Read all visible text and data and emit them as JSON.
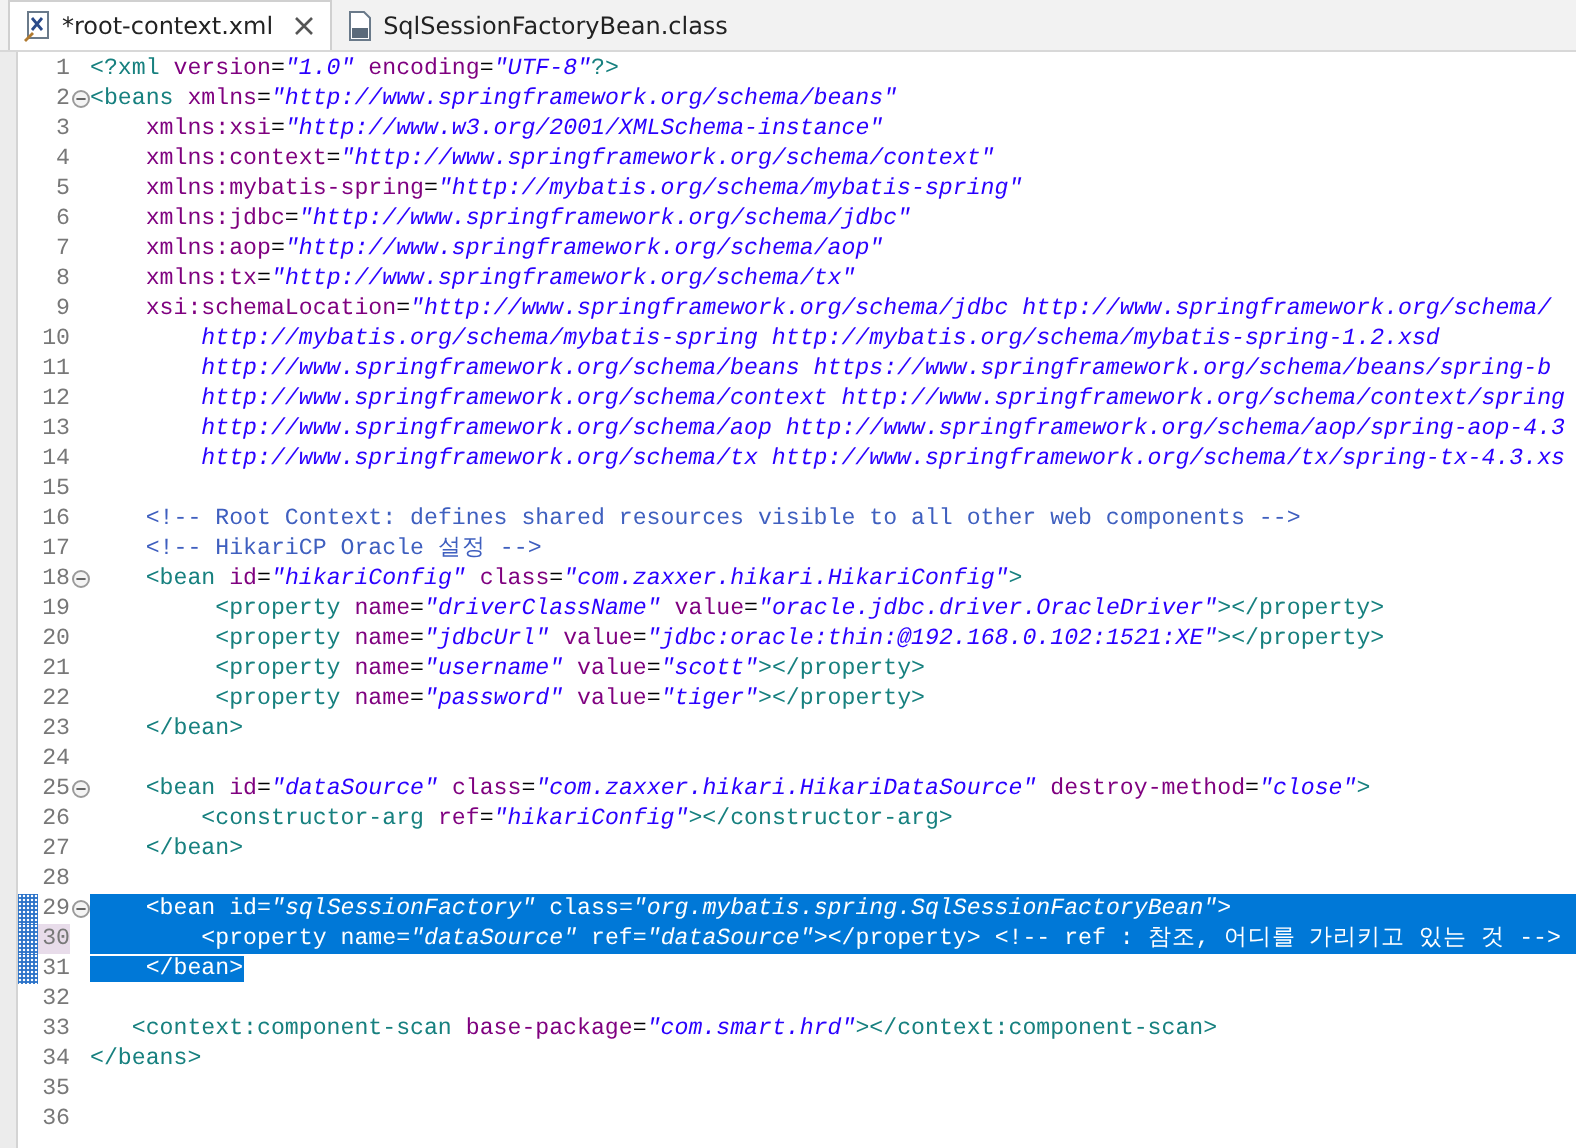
{
  "tabs": [
    {
      "label": "*root-context.xml",
      "selected": true,
      "kind": "xml",
      "closable": true
    },
    {
      "label": "SqlSessionFactoryBean.class",
      "selected": false,
      "kind": "class",
      "closable": false
    }
  ],
  "lines": [
    {
      "number": "1",
      "selected": false,
      "current": false,
      "changed": false,
      "tokens": [
        {
          "kind": "tag",
          "text": "<?xml "
        },
        {
          "kind": "attr",
          "text": "version"
        },
        {
          "kind": "eq",
          "text": "="
        },
        {
          "kind": "value",
          "text": "\"1.0\" "
        },
        {
          "kind": "attr",
          "text": "encoding"
        },
        {
          "kind": "eq",
          "text": "="
        },
        {
          "kind": "value",
          "text": "\"UTF-8\""
        },
        {
          "kind": "tag",
          "text": "?>"
        }
      ]
    },
    {
      "number": "2",
      "selected": false,
      "current": false,
      "changed": false,
      "expanded": true,
      "tokens": [
        {
          "kind": "tag",
          "text": "<beans "
        },
        {
          "kind": "attr",
          "text": "xmlns"
        },
        {
          "kind": "eq",
          "text": "="
        },
        {
          "kind": "value",
          "text": "\"http://www.springframework.org/schema/beans\""
        }
      ]
    },
    {
      "number": "3",
      "selected": false,
      "current": false,
      "changed": false,
      "tokens": [
        {
          "kind": "attr",
          "text": "    xmlns:xsi"
        },
        {
          "kind": "eq",
          "text": "="
        },
        {
          "kind": "value",
          "text": "\"http://www.w3.org/2001/XMLSchema-instance\""
        }
      ]
    },
    {
      "number": "4",
      "selected": false,
      "current": false,
      "changed": false,
      "tokens": [
        {
          "kind": "attr",
          "text": "    xmlns:context"
        },
        {
          "kind": "eq",
          "text": "="
        },
        {
          "kind": "value",
          "text": "\"http://www.springframework.org/schema/context\""
        }
      ]
    },
    {
      "number": "5",
      "selected": false,
      "current": false,
      "changed": false,
      "tokens": [
        {
          "kind": "attr",
          "text": "    xmlns:mybatis-spring"
        },
        {
          "kind": "eq",
          "text": "="
        },
        {
          "kind": "value",
          "text": "\"http://mybatis.org/schema/mybatis-spring\""
        }
      ]
    },
    {
      "number": "6",
      "selected": false,
      "current": false,
      "changed": false,
      "tokens": [
        {
          "kind": "attr",
          "text": "    xmlns:jdbc"
        },
        {
          "kind": "eq",
          "text": "="
        },
        {
          "kind": "value",
          "text": "\"http://www.springframework.org/schema/jdbc\""
        }
      ]
    },
    {
      "number": "7",
      "selected": false,
      "current": false,
      "changed": false,
      "tokens": [
        {
          "kind": "attr",
          "text": "    xmlns:aop"
        },
        {
          "kind": "eq",
          "text": "="
        },
        {
          "kind": "value",
          "text": "\"http://www.springframework.org/schema/aop\""
        }
      ]
    },
    {
      "number": "8",
      "selected": false,
      "current": false,
      "changed": false,
      "tokens": [
        {
          "kind": "attr",
          "text": "    xmlns:tx"
        },
        {
          "kind": "eq",
          "text": "="
        },
        {
          "kind": "value",
          "text": "\"http://www.springframework.org/schema/tx\""
        }
      ]
    },
    {
      "number": "9",
      "selected": false,
      "current": false,
      "changed": false,
      "tokens": [
        {
          "kind": "attr",
          "text": "    xsi:schemaLocation"
        },
        {
          "kind": "eq",
          "text": "="
        },
        {
          "kind": "value",
          "text": "\"http://www.springframework.org/schema/jdbc http://www.springframework.org/schema/"
        }
      ]
    },
    {
      "number": "10",
      "selected": false,
      "current": false,
      "changed": false,
      "tokens": [
        {
          "kind": "value",
          "text": "        http://mybatis.org/schema/mybatis-spring http://mybatis.org/schema/mybatis-spring-1.2.xsd"
        }
      ]
    },
    {
      "number": "11",
      "selected": false,
      "current": false,
      "changed": false,
      "tokens": [
        {
          "kind": "value",
          "text": "        http://www.springframework.org/schema/beans https://www.springframework.org/schema/beans/spring-b"
        }
      ]
    },
    {
      "number": "12",
      "selected": false,
      "current": false,
      "changed": false,
      "tokens": [
        {
          "kind": "value",
          "text": "        http://www.springframework.org/schema/context http://www.springframework.org/schema/context/spring"
        }
      ]
    },
    {
      "number": "13",
      "selected": false,
      "current": false,
      "changed": false,
      "tokens": [
        {
          "kind": "value",
          "text": "        http://www.springframework.org/schema/aop http://www.springframework.org/schema/aop/spring-aop-4.3"
        }
      ]
    },
    {
      "number": "14",
      "selected": false,
      "current": false,
      "changed": false,
      "tokens": [
        {
          "kind": "value",
          "text": "        http://www.springframework.org/schema/tx http://www.springframework.org/schema/tx/spring-tx-4.3.xs"
        }
      ]
    },
    {
      "number": "15",
      "selected": false,
      "current": false,
      "changed": false
    },
    {
      "number": "16",
      "selected": false,
      "current": false,
      "changed": false,
      "tokens": [
        {
          "kind": "comment",
          "text": "    <!-- Root Context: defines shared resources visible to all other web components -->"
        }
      ]
    },
    {
      "number": "17",
      "selected": false,
      "current": false,
      "changed": false,
      "tokens": [
        {
          "kind": "comment",
          "text": "    <!-- HikariCP Oracle 설정 -->"
        }
      ]
    },
    {
      "number": "18",
      "selected": false,
      "current": false,
      "changed": false,
      "expanded": true,
      "tokens": [
        {
          "kind": "tag",
          "text": "    <bean "
        },
        {
          "kind": "attr",
          "text": "id"
        },
        {
          "kind": "eq",
          "text": "="
        },
        {
          "kind": "value",
          "text": "\"hikariConfig\" "
        },
        {
          "kind": "attr",
          "text": "class"
        },
        {
          "kind": "eq",
          "text": "="
        },
        {
          "kind": "value",
          "text": "\"com.zaxxer.hikari.HikariConfig\""
        },
        {
          "kind": "tag",
          "text": ">"
        }
      ]
    },
    {
      "number": "19",
      "selected": false,
      "current": false,
      "changed": false,
      "tokens": [
        {
          "kind": "tag",
          "text": "         <property "
        },
        {
          "kind": "attr",
          "text": "name"
        },
        {
          "kind": "eq",
          "text": "="
        },
        {
          "kind": "value",
          "text": "\"driverClassName\" "
        },
        {
          "kind": "attr",
          "text": "value"
        },
        {
          "kind": "eq",
          "text": "="
        },
        {
          "kind": "value",
          "text": "\"oracle.jdbc.driver.OracleDriver\""
        },
        {
          "kind": "tag",
          "text": "></property>"
        }
      ]
    },
    {
      "number": "20",
      "selected": false,
      "current": false,
      "changed": false,
      "tokens": [
        {
          "kind": "tag",
          "text": "         <property "
        },
        {
          "kind": "attr",
          "text": "name"
        },
        {
          "kind": "eq",
          "text": "="
        },
        {
          "kind": "value",
          "text": "\"jdbcUrl\" "
        },
        {
          "kind": "attr",
          "text": "value"
        },
        {
          "kind": "eq",
          "text": "="
        },
        {
          "kind": "value",
          "text": "\"jdbc:oracle:thin:@192.168.0.102:1521:XE\""
        },
        {
          "kind": "tag",
          "text": "></property>"
        }
      ]
    },
    {
      "number": "21",
      "selected": false,
      "current": false,
      "changed": false,
      "tokens": [
        {
          "kind": "tag",
          "text": "         <property "
        },
        {
          "kind": "attr",
          "text": "name"
        },
        {
          "kind": "eq",
          "text": "="
        },
        {
          "kind": "value",
          "text": "\"username\" "
        },
        {
          "kind": "attr",
          "text": "value"
        },
        {
          "kind": "eq",
          "text": "="
        },
        {
          "kind": "value",
          "text": "\"scott\""
        },
        {
          "kind": "tag",
          "text": "></property>"
        }
      ]
    },
    {
      "number": "22",
      "selected": false,
      "current": false,
      "changed": false,
      "tokens": [
        {
          "kind": "tag",
          "text": "         <property "
        },
        {
          "kind": "attr",
          "text": "name"
        },
        {
          "kind": "eq",
          "text": "="
        },
        {
          "kind": "value",
          "text": "\"password\" "
        },
        {
          "kind": "attr",
          "text": "value"
        },
        {
          "kind": "eq",
          "text": "="
        },
        {
          "kind": "value",
          "text": "\"tiger\""
        },
        {
          "kind": "tag",
          "text": "></property>"
        }
      ]
    },
    {
      "number": "23",
      "selected": false,
      "current": false,
      "changed": false,
      "tokens": [
        {
          "kind": "tag",
          "text": "    </bean>"
        }
      ]
    },
    {
      "number": "24",
      "selected": false,
      "current": false,
      "changed": false
    },
    {
      "number": "25",
      "selected": false,
      "current": false,
      "changed": false,
      "expanded": true,
      "tokens": [
        {
          "kind": "tag",
          "text": "    <bean "
        },
        {
          "kind": "attr",
          "text": "id"
        },
        {
          "kind": "eq",
          "text": "="
        },
        {
          "kind": "value",
          "text": "\"dataSource\" "
        },
        {
          "kind": "attr",
          "text": "class"
        },
        {
          "kind": "eq",
          "text": "="
        },
        {
          "kind": "value",
          "text": "\"com.zaxxer.hikari.HikariDataSource\" "
        },
        {
          "kind": "attr",
          "text": "destroy-method"
        },
        {
          "kind": "eq",
          "text": "="
        },
        {
          "kind": "value",
          "text": "\"close\""
        },
        {
          "kind": "tag",
          "text": ">"
        }
      ]
    },
    {
      "number": "26",
      "selected": false,
      "current": false,
      "changed": false,
      "tokens": [
        {
          "kind": "tag",
          "text": "        <constructor-arg "
        },
        {
          "kind": "attr",
          "text": "ref"
        },
        {
          "kind": "eq",
          "text": "="
        },
        {
          "kind": "value",
          "text": "\"hikariConfig\""
        },
        {
          "kind": "tag",
          "text": "></constructor-arg>"
        }
      ]
    },
    {
      "number": "27",
      "selected": false,
      "current": false,
      "changed": false,
      "tokens": [
        {
          "kind": "tag",
          "text": "    </bean>"
        }
      ]
    },
    {
      "number": "28",
      "selected": false,
      "current": false,
      "changed": false
    },
    {
      "number": "29",
      "selected": true,
      "current": false,
      "changed": true,
      "expanded": true,
      "tokens": [
        {
          "kind": "tag",
          "text": "    <bean "
        },
        {
          "kind": "attr",
          "text": "id"
        },
        {
          "kind": "eq",
          "text": "="
        },
        {
          "kind": "value",
          "text": "\"sqlSessionFactory\" "
        },
        {
          "kind": "attr",
          "text": "class"
        },
        {
          "kind": "eq",
          "text": "="
        },
        {
          "kind": "value",
          "text": "\"org.mybatis.spring.SqlSessionFactoryBean\""
        },
        {
          "kind": "tag",
          "text": ">"
        }
      ]
    },
    {
      "number": "30",
      "selected": true,
      "current": true,
      "changed": true,
      "tokens": [
        {
          "kind": "tag",
          "text": "        <property "
        },
        {
          "kind": "attr",
          "text": "name"
        },
        {
          "kind": "eq",
          "text": "="
        },
        {
          "kind": "value",
          "text": "\"dataSource\" "
        },
        {
          "kind": "attr",
          "text": "ref"
        },
        {
          "kind": "eq",
          "text": "="
        },
        {
          "kind": "value",
          "text": "\"dataSource\""
        },
        {
          "kind": "tag",
          "text": "></property> "
        },
        {
          "kind": "comment",
          "text": "<!-- ref : 참조, 어디를 가리키고 있는 것 -->"
        }
      ]
    },
    {
      "number": "31",
      "selected": true,
      "current": false,
      "changed": true,
      "tokens": [
        {
          "kind": "tag",
          "text": "    </bean>"
        }
      ]
    },
    {
      "number": "32",
      "selected": false,
      "current": false,
      "changed": false
    },
    {
      "number": "33",
      "selected": false,
      "current": false,
      "changed": false,
      "tokens": [
        {
          "kind": "tag",
          "text": "   <context:component-scan "
        },
        {
          "kind": "attr",
          "text": "base-package"
        },
        {
          "kind": "eq",
          "text": "="
        },
        {
          "kind": "value",
          "text": "\"com.smart.hrd\""
        },
        {
          "kind": "tag",
          "text": "></context:component-scan>"
        }
      ]
    },
    {
      "number": "34",
      "selected": false,
      "current": false,
      "changed": false,
      "tokens": [
        {
          "kind": "tag",
          "text": "</beans>"
        }
      ]
    },
    {
      "number": "35",
      "selected": false,
      "current": false,
      "changed": false
    },
    {
      "number": "36",
      "selected": false,
      "current": false,
      "changed": false
    }
  ]
}
